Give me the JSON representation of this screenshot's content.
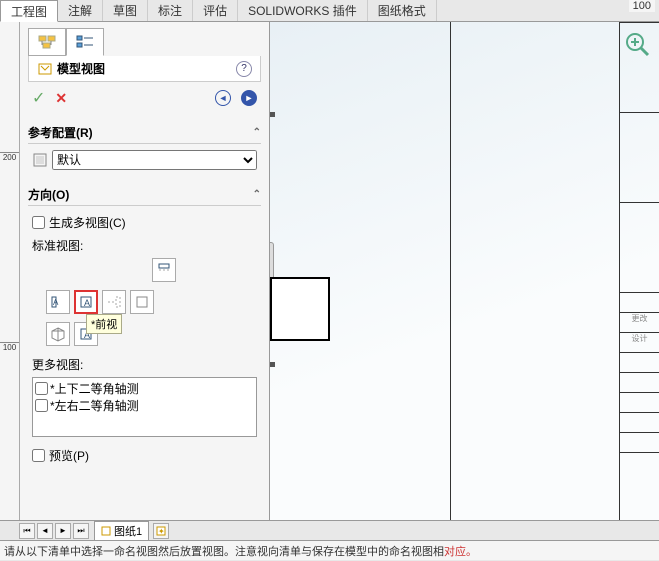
{
  "ribbon": {
    "tabs": [
      "工程图",
      "注解",
      "草图",
      "标注",
      "评估",
      "SOLIDWORKS 插件",
      "图纸格式"
    ],
    "active": 0
  },
  "hruler_label": "100",
  "vruler_labels": [
    "200",
    "100"
  ],
  "panel": {
    "title": "模型视图",
    "help": "?"
  },
  "ref_config": {
    "heading": "参考配置(R)",
    "options": [
      "默认"
    ],
    "selected": "默认"
  },
  "orientation": {
    "heading": "方向(O)",
    "multiview_label": "生成多视图(C)",
    "standard_label": "标准视图:",
    "tooltip": "*前视",
    "more_label": "更多视图:",
    "more_items": [
      "*上下二等角轴测",
      "*左右二等角轴测"
    ],
    "preview_label": "预览(P)"
  },
  "titleblock_cells": [
    "",
    "",
    "",
    "更改",
    "",
    "设计",
    "",
    "",
    "",
    "",
    ""
  ],
  "sheet_tab": "图纸1",
  "status_text_a": "请从以下清单中选择一命名视图然后放置视图。注意视向清单与保存在模型中的命名视图相",
  "status_text_b": "对应。"
}
